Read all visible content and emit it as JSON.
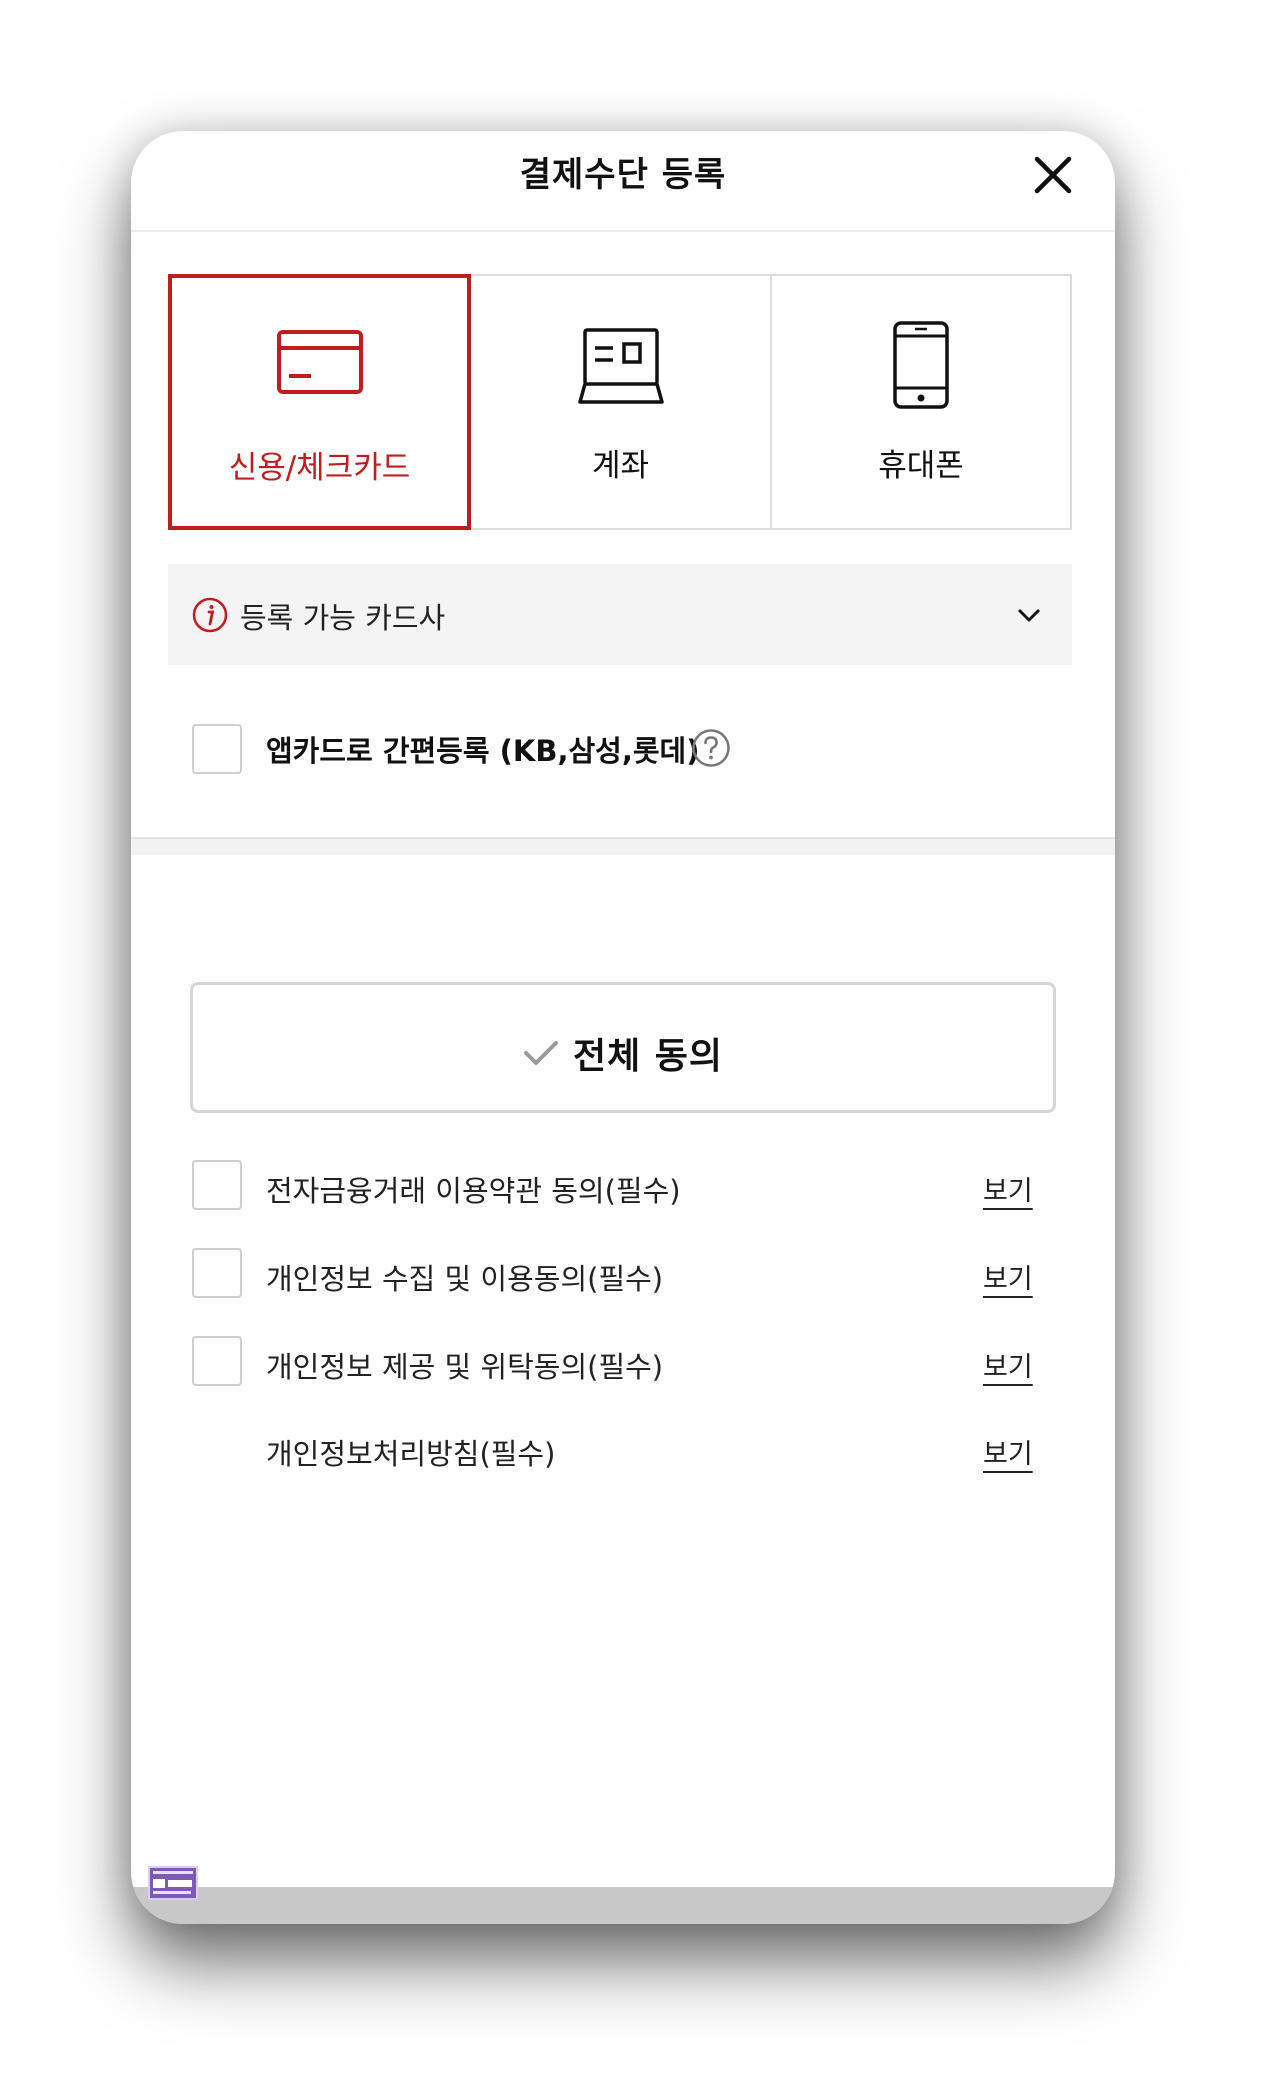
{
  "header": {
    "title": "결제수단 등록"
  },
  "methods": [
    {
      "label": "신용/체크카드",
      "icon": "credit-card-icon",
      "selected": true
    },
    {
      "label": "계좌",
      "icon": "bank-account-icon",
      "selected": false
    },
    {
      "label": "휴대폰",
      "icon": "mobile-phone-icon",
      "selected": false
    }
  ],
  "card_companies": {
    "label": "등록 가능 카드사"
  },
  "app_card": {
    "label": "앱카드로 간편등록 (KB,삼성,롯데)",
    "checked": false
  },
  "agreement": {
    "all_label": "전체 동의",
    "terms": [
      {
        "label": "전자금융거래 이용약관 동의(필수)",
        "view": "보기",
        "has_checkbox": true,
        "checked": false
      },
      {
        "label": "개인정보 수집 및 이용동의(필수)",
        "view": "보기",
        "has_checkbox": true,
        "checked": false
      },
      {
        "label": "개인정보 제공 및 위탁동의(필수)",
        "view": "보기",
        "has_checkbox": true,
        "checked": false
      },
      {
        "label": "개인정보처리방침(필수)",
        "view": "보기",
        "has_checkbox": false
      }
    ]
  },
  "colors": {
    "accent": "#c41c1c",
    "border": "#dddddd",
    "info_bg": "#f4f4f4"
  }
}
